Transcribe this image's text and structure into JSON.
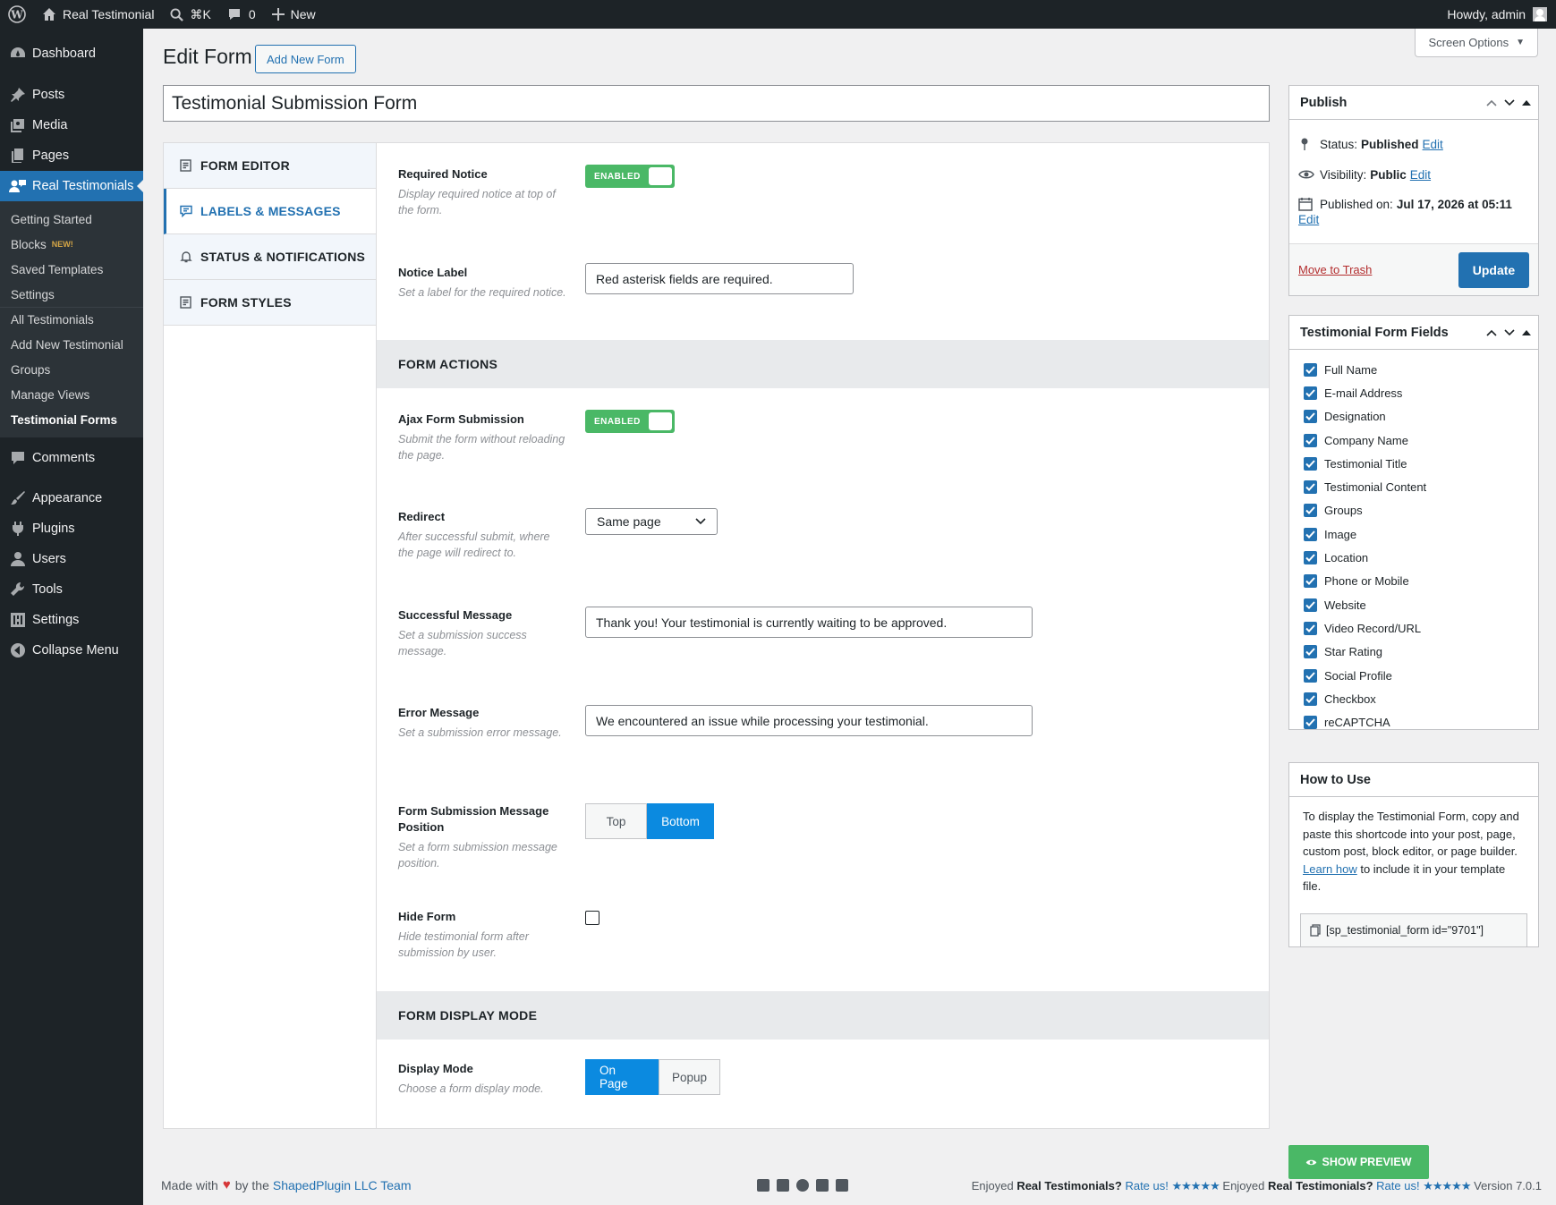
{
  "adminbar": {
    "site_name": "Real Testimonial",
    "search_shortcut": "⌘K",
    "comments_count": "0",
    "new_label": "New",
    "howdy": "Howdy, admin"
  },
  "sidebar": {
    "dashboard": "Dashboard",
    "posts": "Posts",
    "media": "Media",
    "pages": "Pages",
    "real_testimonials": "Real Testimonials",
    "sub": {
      "getting_started": "Getting Started",
      "blocks": "Blocks",
      "blocks_badge": "NEW!",
      "saved_templates": "Saved Templates",
      "settings": "Settings",
      "all_testimonials": "All Testimonials",
      "add_new_testimonial": "Add New Testimonial",
      "groups": "Groups",
      "manage_views": "Manage Views",
      "testimonial_forms": "Testimonial Forms"
    },
    "comments": "Comments",
    "appearance": "Appearance",
    "plugins": "Plugins",
    "users": "Users",
    "tools": "Tools",
    "settings": "Settings",
    "collapse": "Collapse Menu"
  },
  "header": {
    "title": "Edit Form",
    "add_new": "Add New Form",
    "screen_options": "Screen Options",
    "form_title": "Testimonial Submission Form"
  },
  "tabs": {
    "form_editor": "FORM EDITOR",
    "labels_messages": "LABELS & MESSAGES",
    "status_notifications": "STATUS & NOTIFICATIONS",
    "form_styles": "FORM STYLES"
  },
  "fields": {
    "required_notice": {
      "label": "Required Notice",
      "desc": "Display required notice at top of the form.",
      "state": "ENABLED"
    },
    "notice_label": {
      "label": "Notice Label",
      "desc": "Set a label for the required notice.",
      "value": "Red asterisk fields are required."
    },
    "section_actions": "FORM ACTIONS",
    "ajax": {
      "label": "Ajax Form Submission",
      "desc": "Submit the form without reloading the page.",
      "state": "ENABLED"
    },
    "redirect": {
      "label": "Redirect",
      "desc": "After successful submit, where the page will redirect to.",
      "value": "Same page"
    },
    "success": {
      "label": "Successful Message",
      "desc": "Set a submission success message.",
      "value": "Thank you! Your testimonial is currently waiting to be approved."
    },
    "error": {
      "label": "Error Message",
      "desc": "Set a submission error message.",
      "value": "We encountered an issue while processing your testimonial."
    },
    "position": {
      "label": "Form Submission Message Position",
      "desc": "Set a form submission message position.",
      "opt_top": "Top",
      "opt_bottom": "Bottom"
    },
    "hide_form": {
      "label": "Hide Form",
      "desc": "Hide testimonial form after submission by user."
    },
    "section_display": "FORM DISPLAY MODE",
    "display_mode": {
      "label": "Display Mode",
      "desc": "Choose a form display mode.",
      "opt_on_page": "On Page",
      "opt_popup": "Popup"
    }
  },
  "publish": {
    "title": "Publish",
    "status_label": "Status:",
    "status_value": "Published",
    "visibility_label": "Visibility:",
    "visibility_value": "Public",
    "published_label": "Published on:",
    "published_value": "Jul 17, 2026 at 05:11",
    "edit": "Edit",
    "trash": "Move to Trash",
    "update": "Update"
  },
  "form_fields": {
    "title": "Testimonial Form Fields",
    "items": [
      "Full Name",
      "E-mail Address",
      "Designation",
      "Company Name",
      "Testimonial Title",
      "Testimonial Content",
      "Groups",
      "Image",
      "Location",
      "Phone or Mobile",
      "Website",
      "Video Record/URL",
      "Star Rating",
      "Social Profile",
      "Checkbox",
      "reCAPTCHA"
    ]
  },
  "howto": {
    "title": "How to Use",
    "text_before": "To display the Testimonial Form, copy and paste this shortcode into your post, page, custom post, block editor, or page builder.",
    "learn_how": "Learn how",
    "text_after": "to include it in your template file.",
    "shortcode": "[sp_testimonial_form id=\"9701\"]"
  },
  "preview_button": "SHOW PREVIEW",
  "footer": {
    "made_with": "Made with",
    "by_the": "by the",
    "team": "ShapedPlugin LLC Team",
    "enjoyed": "Enjoyed",
    "plugin": "Real Testimonials?",
    "rate": "Rate us!",
    "stars": "★★★★★",
    "version": "Version 7.0.1"
  }
}
